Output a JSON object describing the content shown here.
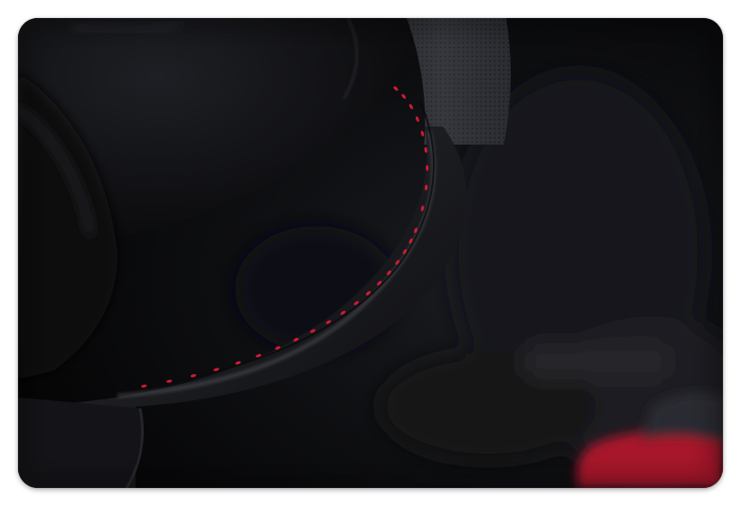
{
  "image": {
    "subject": "steering-wheel-closeup",
    "colors": {
      "background": "#ffffff",
      "leather": "#1c1d21",
      "perforated_leather": "#2a2b30",
      "stitching": "#d21a32",
      "seat_accent": "#b0182c",
      "interior_shadow": "#070709"
    }
  }
}
